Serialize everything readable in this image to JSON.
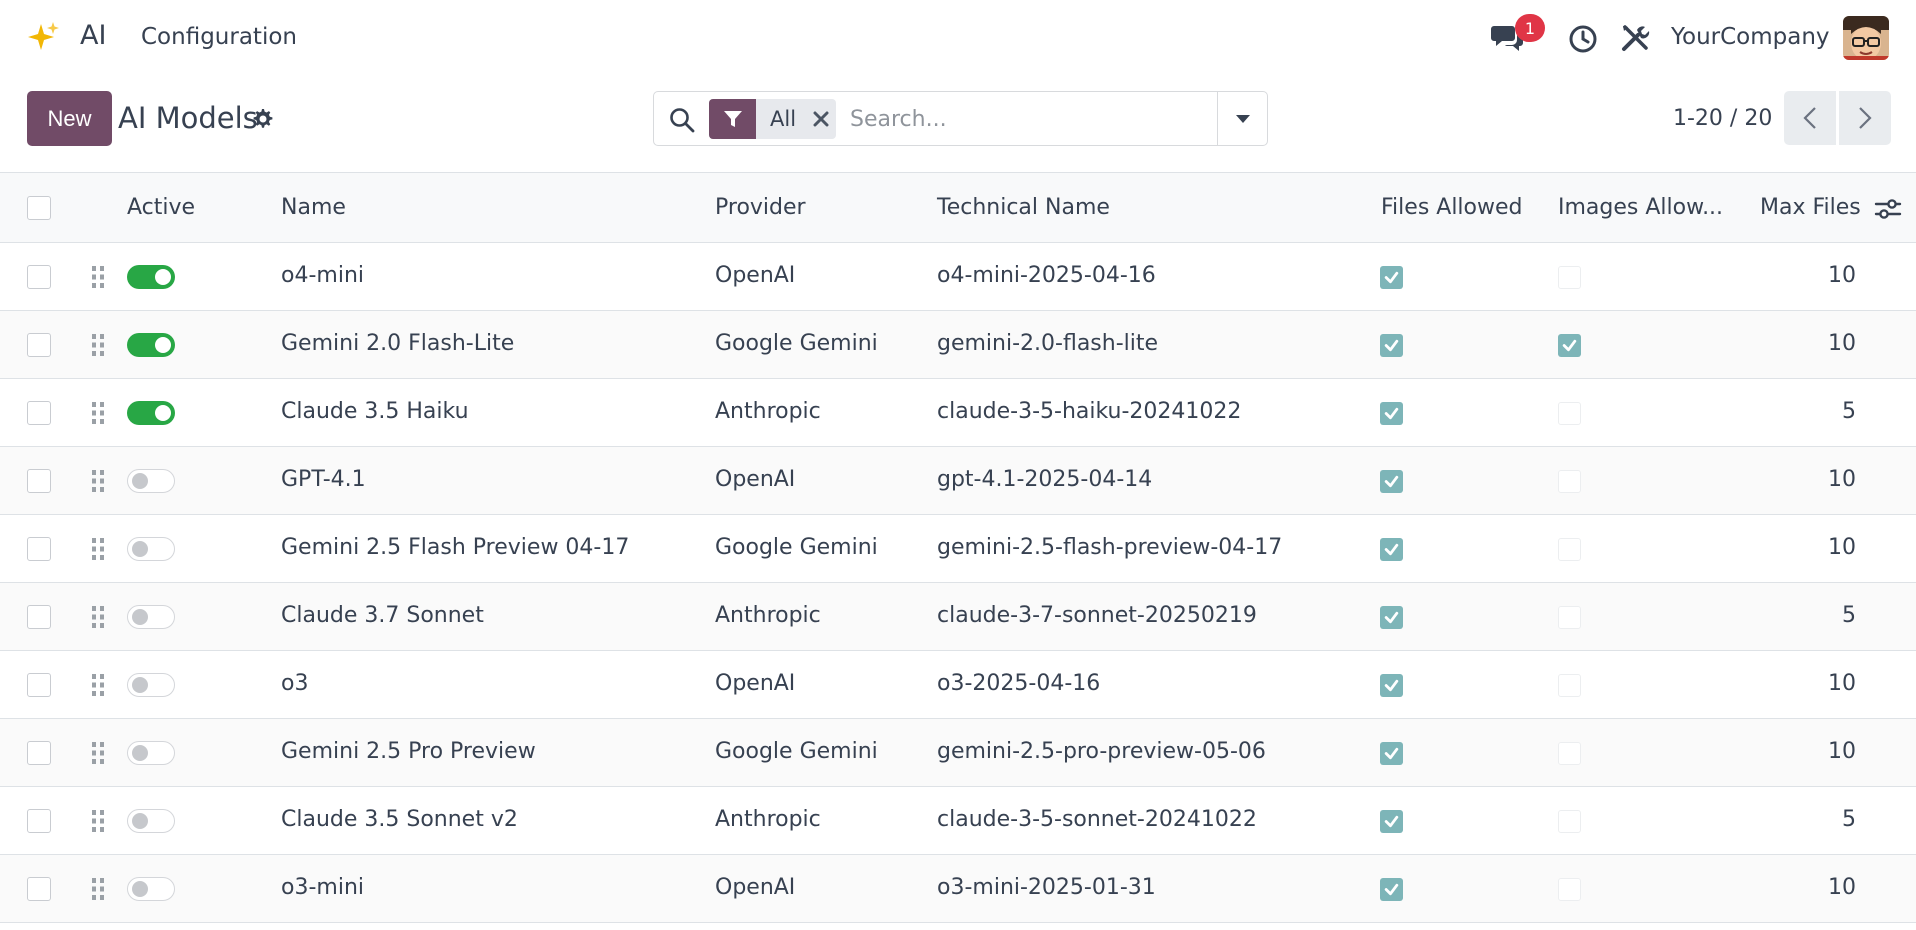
{
  "nav": {
    "app_name": "AI",
    "menu_configuration": "Configuration",
    "notification_count": "1",
    "company": "YourCompany"
  },
  "control": {
    "new_label": "New",
    "title": "AI Models",
    "search": {
      "facet_value": "All",
      "placeholder": "Search..."
    },
    "pager": "1-20 / 20"
  },
  "table": {
    "headers": {
      "active": "Active",
      "name": "Name",
      "provider": "Provider",
      "technical_name": "Technical Name",
      "files_allowed": "Files Allowed",
      "images_allowed": "Images Allow...",
      "max_files": "Max Files"
    },
    "rows": [
      {
        "active": true,
        "name": "o4-mini",
        "provider": "OpenAI",
        "technical_name": "o4-mini-2025-04-16",
        "files_allowed": true,
        "images_allowed": false,
        "max_files": "10"
      },
      {
        "active": true,
        "name": "Gemini 2.0 Flash-Lite",
        "provider": "Google Gemini",
        "technical_name": "gemini-2.0-flash-lite",
        "files_allowed": true,
        "images_allowed": true,
        "max_files": "10"
      },
      {
        "active": true,
        "name": "Claude 3.5 Haiku",
        "provider": "Anthropic",
        "technical_name": "claude-3-5-haiku-20241022",
        "files_allowed": true,
        "images_allowed": false,
        "max_files": "5"
      },
      {
        "active": false,
        "name": "GPT-4.1",
        "provider": "OpenAI",
        "technical_name": "gpt-4.1-2025-04-14",
        "files_allowed": true,
        "images_allowed": false,
        "max_files": "10"
      },
      {
        "active": false,
        "name": "Gemini 2.5 Flash Preview 04-17",
        "provider": "Google Gemini",
        "technical_name": "gemini-2.5-flash-preview-04-17",
        "files_allowed": true,
        "images_allowed": false,
        "max_files": "10"
      },
      {
        "active": false,
        "name": "Claude 3.7 Sonnet",
        "provider": "Anthropic",
        "technical_name": "claude-3-7-sonnet-20250219",
        "files_allowed": true,
        "images_allowed": false,
        "max_files": "5"
      },
      {
        "active": false,
        "name": "o3",
        "provider": "OpenAI",
        "technical_name": "o3-2025-04-16",
        "files_allowed": true,
        "images_allowed": false,
        "max_files": "10"
      },
      {
        "active": false,
        "name": "Gemini 2.5 Pro Preview",
        "provider": "Google Gemini",
        "technical_name": "gemini-2.5-pro-preview-05-06",
        "files_allowed": true,
        "images_allowed": false,
        "max_files": "10"
      },
      {
        "active": false,
        "name": "Claude 3.5 Sonnet v2",
        "provider": "Anthropic",
        "technical_name": "claude-3-5-sonnet-20241022",
        "files_allowed": true,
        "images_allowed": false,
        "max_files": "5"
      },
      {
        "active": false,
        "name": "o3-mini",
        "provider": "OpenAI",
        "technical_name": "o3-mini-2025-01-31",
        "files_allowed": true,
        "images_allowed": false,
        "max_files": "10"
      }
    ]
  },
  "colors": {
    "brand": "#714b67",
    "toggle_on": "#28a745",
    "checkbox_checked": "#7db5b8",
    "badge": "#e03546"
  },
  "icons": [
    "sparkles-icon",
    "chat-icon",
    "clock-icon",
    "tools-icon",
    "gear-icon",
    "search-icon",
    "filter-icon",
    "close-icon",
    "caret-down-icon",
    "chevron-left-icon",
    "chevron-right-icon",
    "drag-handle-icon",
    "column-settings-icon"
  ]
}
